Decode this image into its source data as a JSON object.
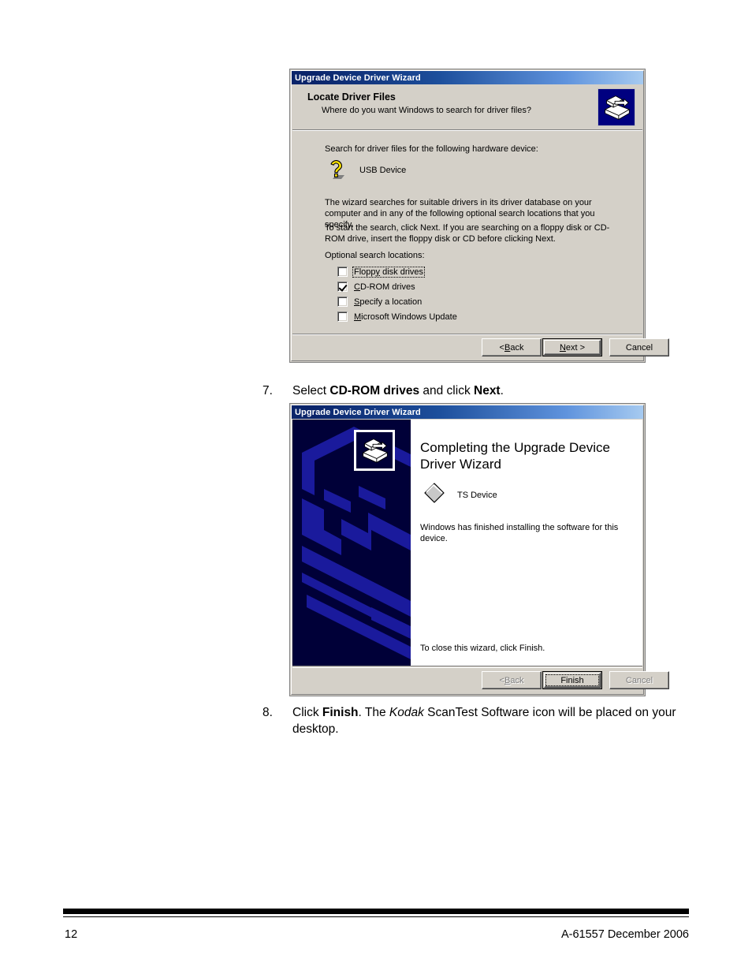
{
  "document": {
    "page_number": "12",
    "footer_right": "A-61557 December 2006",
    "steps": [
      {
        "number": "7.",
        "segments": [
          {
            "text": "Select ",
            "style": "normal"
          },
          {
            "text": "CD-ROM drives",
            "style": "bold"
          },
          {
            "text": " and click ",
            "style": "normal"
          },
          {
            "text": "Next",
            "style": "bold"
          },
          {
            "text": ".",
            "style": "normal"
          }
        ]
      },
      {
        "number": "8.",
        "segments": [
          {
            "text": "Click ",
            "style": "normal"
          },
          {
            "text": "Finish",
            "style": "bold"
          },
          {
            "text": ". The ",
            "style": "normal"
          },
          {
            "text": "Kodak",
            "style": "italic"
          },
          {
            "text": " ScanTest Software icon will be placed on your desktop.",
            "style": "normal"
          }
        ]
      }
    ]
  },
  "dialog_locate": {
    "title": "Upgrade Device Driver Wizard",
    "header": {
      "title": "Locate Driver Files",
      "subtitle": "Where do you want Windows to search for driver files?",
      "icon": "wizard-driver-icon"
    },
    "body": {
      "intro": "Search for driver files for the following hardware device:",
      "device_icon": "question-mark-icon",
      "device_name": "USB Device",
      "paragraph1": "The wizard searches for suitable drivers in its driver database on your computer and in any of the following optional search locations that you specify.",
      "paragraph2": "To start the search, click Next. If you are searching on a floppy disk or CD-ROM drive, insert the floppy disk or CD before clicking Next.",
      "options_label": "Optional search locations:",
      "checkboxes": [
        {
          "label_pre": "Flopp",
          "mnemonic": "y",
          "label_post": " disk drives",
          "checked": false,
          "focused": true
        },
        {
          "label_pre": "",
          "mnemonic": "C",
          "label_post": "D-ROM drives",
          "checked": true,
          "focused": false
        },
        {
          "label_pre": "",
          "mnemonic": "S",
          "label_post": "pecify a location",
          "checked": false,
          "focused": false
        },
        {
          "label_pre": "",
          "mnemonic": "M",
          "label_post": "icrosoft Windows Update",
          "checked": false,
          "focused": false
        }
      ]
    },
    "buttons": {
      "back": {
        "pre": "< ",
        "mnemonic": "B",
        "post": "ack",
        "disabled": false,
        "default": false
      },
      "next": {
        "pre": "",
        "mnemonic": "N",
        "post": "ext >",
        "disabled": false,
        "default": true
      },
      "cancel": {
        "pre": "Cancel",
        "mnemonic": "",
        "post": "",
        "disabled": false,
        "default": false
      }
    }
  },
  "dialog_complete": {
    "title": "Upgrade Device Driver Wizard",
    "heading": "Completing the Upgrade Device Driver Wizard",
    "sidebar_icon": "wizard-driver-icon",
    "device_icon": "diamond-device-icon",
    "device_name": "TS Device",
    "text1": "Windows has finished installing the software for this device.",
    "text2": "To close this wizard, click Finish.",
    "buttons": {
      "back": {
        "pre": "< ",
        "mnemonic": "B",
        "post": "ack",
        "disabled": true,
        "default": false
      },
      "finish": {
        "pre": "Finish",
        "mnemonic": "",
        "post": "",
        "disabled": false,
        "default": true
      },
      "cancel": {
        "pre": "Cancel",
        "mnemonic": "",
        "post": "",
        "disabled": true,
        "default": false
      }
    }
  }
}
